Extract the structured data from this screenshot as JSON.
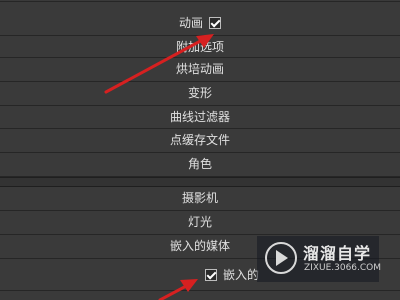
{
  "rows": [
    {
      "label": "动画",
      "checked": true
    },
    {
      "label": "附加选项"
    },
    {
      "label": "烘培动画"
    },
    {
      "label": "变形"
    },
    {
      "label": "曲线过滤器"
    },
    {
      "label": "点缓存文件"
    },
    {
      "label": "角色"
    },
    {
      "label": "摄影机"
    },
    {
      "label": "灯光"
    },
    {
      "label": "嵌入的媒体"
    },
    {
      "label": "嵌入的",
      "checked": true
    }
  ],
  "watermark": {
    "name": "溜溜自学",
    "url": "ZIXUE.3066.COM"
  },
  "colors": {
    "arrow": "#d62020",
    "panel": "#3a3a3a",
    "row_border": "#262626"
  }
}
